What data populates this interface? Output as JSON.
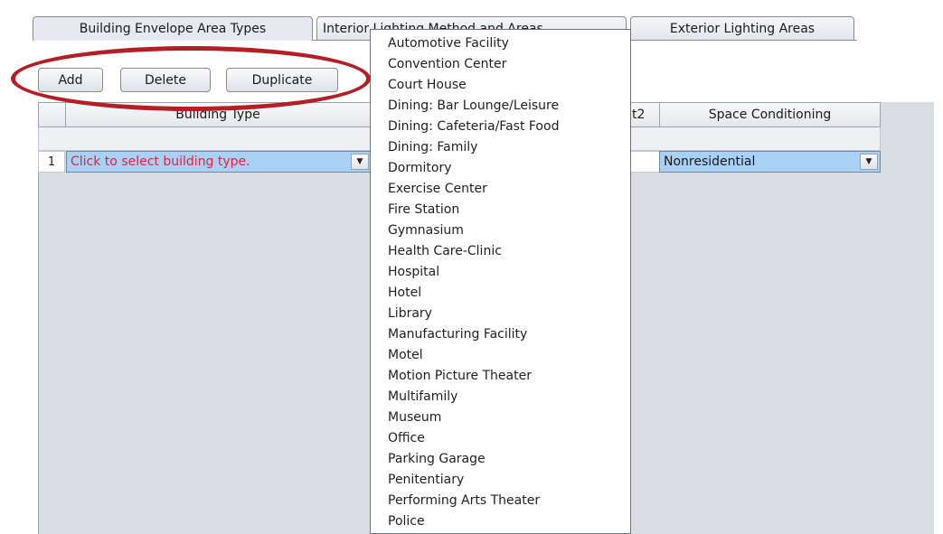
{
  "tabs": [
    {
      "label": "Building Envelope Area Types"
    },
    {
      "label": "Interior Lighting Method and Areas"
    },
    {
      "label": "Exterior Lighting Areas"
    }
  ],
  "toolbar": {
    "add_label": "Add",
    "delete_label": "Delete",
    "duplicate_label": "Duplicate"
  },
  "table": {
    "headers": {
      "building_type": "Building Type",
      "area_partial": "t2",
      "space_conditioning": "Space Conditioning"
    },
    "rows": [
      {
        "number": "1",
        "building_type": "Click to select building type.",
        "space_conditioning": "Nonresidential"
      }
    ]
  },
  "dropdown": {
    "options": [
      "Automotive Facility",
      "Convention Center",
      "Court House",
      "Dining: Bar Lounge/Leisure",
      "Dining: Cafeteria/Fast Food",
      "Dining: Family",
      "Dormitory",
      "Exercise Center",
      "Fire Station",
      "Gymnasium",
      "Health Care-Clinic",
      "Hospital",
      "Hotel",
      "Library",
      "Manufacturing Facility",
      "Motel",
      "Motion Picture Theater",
      "Multifamily",
      "Museum",
      "Office",
      "Parking Garage",
      "Penitentiary",
      "Performing Arts Theater",
      "Police"
    ]
  },
  "colors": {
    "highlight_ring": "#b31f25",
    "placeholder_text": "#e0243a",
    "selected_cell": "#a9d0f5",
    "grid_background": "#d9dce3"
  },
  "icons": {
    "combo_arrow": "chevron-down-icon"
  }
}
